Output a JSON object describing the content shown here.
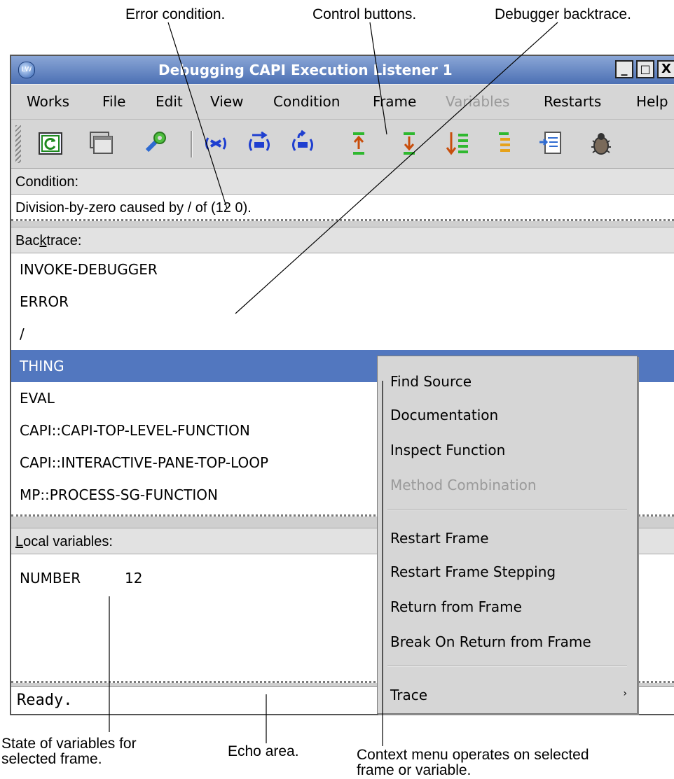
{
  "callouts": {
    "error_condition": "Error condition.",
    "control_buttons": "Control buttons.",
    "debugger_backtrace": "Debugger backtrace.",
    "state_of_variables_line1": "State of variables for",
    "state_of_variables_line2": "selected frame.",
    "echo_area": "Echo area.",
    "context_menu_line1": "Context menu operates on selected",
    "context_menu_line2": "frame or variable."
  },
  "window": {
    "title": "Debugging CAPI Execution Listener 1",
    "app_icon_text": "LW",
    "buttons": {
      "minimize": "_",
      "maximize": "□",
      "close": "X"
    }
  },
  "menubar": {
    "items": [
      {
        "label": "Works",
        "enabled": true
      },
      {
        "label": "File",
        "enabled": true
      },
      {
        "label": "Edit",
        "enabled": true
      },
      {
        "label": "View",
        "enabled": true
      },
      {
        "label": "Condition",
        "enabled": true
      },
      {
        "label": "Frame",
        "enabled": true
      },
      {
        "label": "Variables",
        "enabled": false
      },
      {
        "label": "Restarts",
        "enabled": true
      },
      {
        "label": "Help",
        "enabled": true
      }
    ]
  },
  "toolbar": {
    "buttons": [
      "refresh-icon",
      "listener-window-icon",
      "debugger-tools-icon",
      "abort-icon",
      "continue-icon",
      "restart-icon",
      "step-up-icon",
      "step-down-icon",
      "backtrace-list-icon",
      "frame-list-icon",
      "find-source-icon",
      "bug-icon"
    ]
  },
  "condition": {
    "label": "Condition:",
    "text": "Division-by-zero caused by / of (12 0)."
  },
  "backtrace": {
    "label_prefix": "Bac",
    "label_underlined": "k",
    "label_suffix": "trace:",
    "frames": [
      "INVOKE-DEBUGGER",
      "ERROR",
      "/",
      "THING",
      "EVAL",
      "CAPI::CAPI-TOP-LEVEL-FUNCTION",
      "CAPI::INTERACTIVE-PANE-TOP-LOOP",
      "MP::PROCESS-SG-FUNCTION"
    ],
    "selected": "THING"
  },
  "local_variables": {
    "label_underlined": "L",
    "label_suffix": "ocal variables:",
    "rows": [
      {
        "name": "NUMBER",
        "value": "12"
      }
    ]
  },
  "echo_area": {
    "text": "Ready."
  },
  "context_menu": {
    "group1": [
      "Find Source",
      "Documentation",
      "Inspect Function",
      "Method Combination"
    ],
    "group1_disabled": "Method Combination",
    "group2": [
      "Restart Frame",
      "Restart Frame Stepping",
      "Return from Frame",
      "Break On Return from Frame"
    ],
    "group3": [
      "Trace"
    ],
    "submenu_arrow": "›"
  },
  "colors": {
    "selection": "#5277bf",
    "titlebar_top": "#8aa6d6",
    "titlebar_bottom": "#4c70b4",
    "disabled_text": "#9a9a9a",
    "pane_background": "#ffffff",
    "chrome_background": "#d6d6d6"
  }
}
